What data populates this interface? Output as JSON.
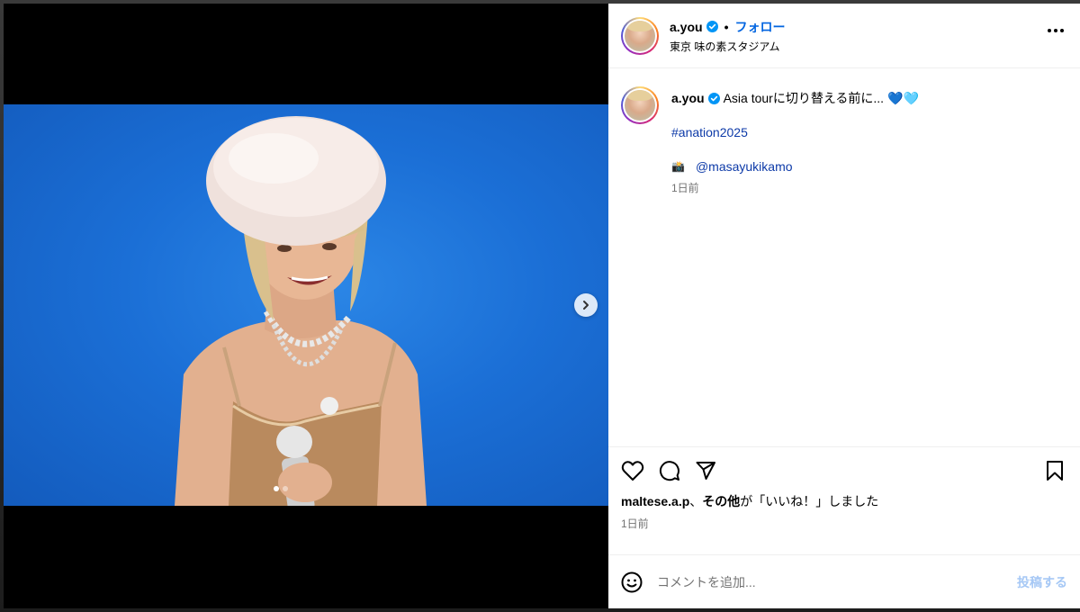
{
  "post": {
    "username": "a.you",
    "follow_label": "フォロー",
    "location": "東京 味の素スタジアム",
    "caption_text": "Asia tourに切り替える前に...",
    "caption_emoji": "💙🩵",
    "hashtag": "#anation2025",
    "credit_emoji": "📸",
    "credit_mention": "@masayukikamo",
    "caption_time": "1日前",
    "likes_user": "maltese.a.p",
    "likes_sep": "、",
    "likes_others": "その他",
    "likes_suffix": "が「いいね！」しました",
    "post_time": "1日前",
    "comment_placeholder": "コメントを追加...",
    "post_button": "投稿する"
  },
  "carousel": {
    "slide_count": 2,
    "active_slide": 1
  },
  "icons": {
    "verified": "verified-badge-icon",
    "more": "more-options-icon",
    "next": "chevron-right-icon",
    "like": "heart-icon",
    "comment": "comment-icon",
    "share": "send-icon",
    "save": "bookmark-icon",
    "emoji": "emoji-icon"
  },
  "colors": {
    "link": "#0d3aa8",
    "follow": "#0064e0",
    "post_button_disabled": "#a6c8f5",
    "verified": "#0095f6",
    "photo_bg": "#1b6fd6"
  }
}
